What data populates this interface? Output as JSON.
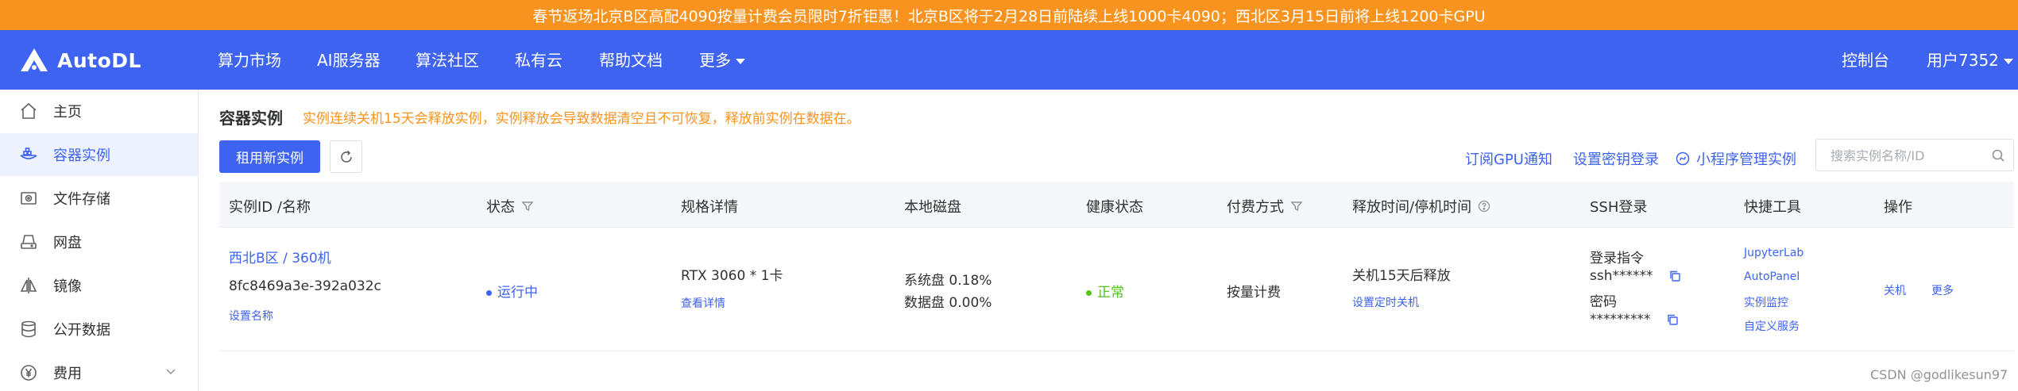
{
  "banner": {
    "text": "春节返场北京B区高配4090按量计费会员限时7折钜惠！北京B区将于2月28日前陆续上线1000卡4090；西北区3月15日前将上线1200卡GPU"
  },
  "brand": {
    "name": "AutoDL",
    "logo_icon": "autodl-logo-icon"
  },
  "nav": {
    "items": [
      "算力市场",
      "AI服务器",
      "算法社区",
      "私有云",
      "帮助文档"
    ],
    "more": "更多",
    "console": "控制台",
    "user": "用户7352"
  },
  "sidebar": {
    "items": [
      {
        "label": "主页",
        "icon": "home-icon"
      },
      {
        "label": "容器实例",
        "icon": "container-icon",
        "active": true
      },
      {
        "label": "文件存储",
        "icon": "storage-icon"
      },
      {
        "label": "网盘",
        "icon": "netdisk-icon"
      },
      {
        "label": "镜像",
        "icon": "image-icon"
      },
      {
        "label": "公开数据",
        "icon": "database-icon"
      },
      {
        "label": "费用",
        "icon": "yen-icon"
      }
    ]
  },
  "page": {
    "title": "容器实例",
    "warning": "实例连续关机15天会释放实例，实例释放会导致数据清空且不可恢复，释放前实例在数据在。",
    "new_instance": "租用新实例",
    "subscribe_gpu": "订阅GPU通知",
    "set_key_login": "设置密钥登录",
    "mini_program": "小程序管理实例",
    "search_placeholder": "搜索实例名称/ID"
  },
  "table": {
    "headers": {
      "id_name": "实例ID /名称",
      "status": "状态",
      "spec": "规格详情",
      "disk": "本地磁盘",
      "health": "健康状态",
      "billing": "付费方式",
      "release": "释放时间/停机时间",
      "ssh": "SSH登录",
      "tools": "快捷工具",
      "actions": "操作"
    },
    "rows": [
      {
        "region_name": "西北B区 / 360机",
        "instance_id": "8fc8469a3e-392a032c",
        "set_name": "设置名称",
        "status": "运行中",
        "spec": "RTX 3060 * 1卡",
        "spec_detail": "查看详情",
        "system_disk": "系统盘 0.18%",
        "data_disk": "数据盘 0.00%",
        "health": "正常",
        "billing": "按量计费",
        "release": "关机15天后释放",
        "timed_shutdown": "设置定时关机",
        "ssh_cmd_label": "登录指令",
        "ssh_cmd": "ssh******",
        "pwd_label": "密码",
        "pwd": "*********",
        "tools": [
          "JupyterLab",
          "AutoPanel",
          "实例监控",
          "自定义服务"
        ],
        "shutdown": "关机",
        "more": "更多"
      }
    ]
  },
  "colors": {
    "brand": "#3d63f0",
    "banner": "#f7931e",
    "running": "#3d63f0",
    "healthy": "#52c41a"
  },
  "watermark": "CSDN @godlikesun97"
}
